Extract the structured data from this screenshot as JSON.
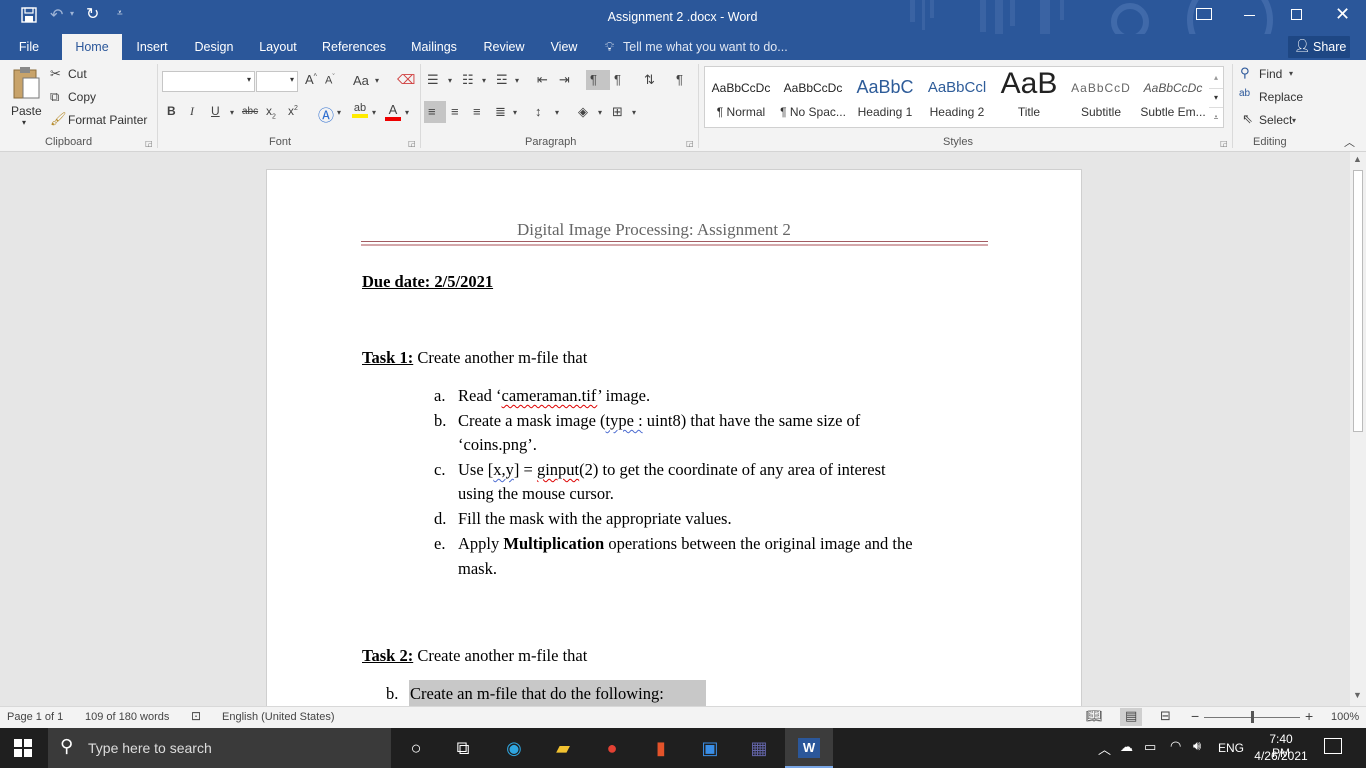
{
  "window": {
    "title": "Assignment 2 .docx - Word",
    "quick_access": {
      "save_icon": "save-icon",
      "undo_icon": "undo-icon",
      "redo_icon": "redo-icon",
      "customize_icon": "customize-icon"
    },
    "controls": {
      "ribbon_display": "ribbon-display-icon",
      "minimize": "minimize-icon",
      "restore": "restore-icon",
      "close": "close-icon"
    }
  },
  "tabs": {
    "items": [
      "File",
      "Home",
      "Insert",
      "Design",
      "Layout",
      "References",
      "Mailings",
      "Review",
      "View"
    ],
    "active": "Home",
    "tell_me": "Tell me what you want to do...",
    "share": "Share"
  },
  "ribbon": {
    "clipboard": {
      "paste": "Paste",
      "cut": "Cut",
      "copy": "Copy",
      "format_painter": "Format Painter",
      "label": "Clipboard"
    },
    "font": {
      "font_name": "",
      "font_size": "",
      "label": "Font",
      "change_case": "Aa"
    },
    "paragraph": {
      "label": "Paragraph"
    },
    "styles": {
      "label": "Styles",
      "items": [
        {
          "preview": "AaBbCcDc",
          "name": "¶ Normal"
        },
        {
          "preview": "AaBbCcDc",
          "name": "¶ No Spac..."
        },
        {
          "preview": "AaBbC",
          "name": "Heading 1"
        },
        {
          "preview": "AaBbCcl",
          "name": "Heading 2"
        },
        {
          "preview": "AaB",
          "name": "Title"
        },
        {
          "preview": "AaBbCcD",
          "name": "Subtitle"
        },
        {
          "preview": "AaBbCcDc",
          "name": "Subtle Em..."
        }
      ]
    },
    "editing": {
      "find": "Find",
      "replace": "Replace",
      "select": "Select",
      "label": "Editing"
    }
  },
  "document": {
    "header": "Digital Image Processing: Assignment 2",
    "due_date": "Due date: 2/5/2021",
    "task1": {
      "label": "Task 1:",
      "text": " Create another m-file that",
      "items": [
        {
          "marker": "a.",
          "line1_a": "Read ‘",
          "line1_sq": "cameraman.tif",
          "line1_b": "’ image."
        },
        {
          "marker": "b.",
          "line1_a": "Create a mask image (",
          "line1_sq": "type :",
          "line1_b": " uint8) that have the same size of",
          "line2": "‘coins.png’."
        },
        {
          "marker": "c.",
          "line1_a": "Use [",
          "line1_sq": "x,y",
          "line1_b": "] = ",
          "line1_sq2": "ginput",
          "line1_c": "(2) to get the coordinate of any area of interest",
          "line2": "using the mouse cursor."
        },
        {
          "marker": "d.",
          "line1": "Fill the mask with the appropriate values."
        },
        {
          "marker": "e.",
          "line1_a": "Apply ",
          "line1_bold": "Multiplication",
          "line1_b": " operations between the original image and the",
          "line2": "mask."
        }
      ]
    },
    "task2": {
      "label": "Task 2:",
      "text": " Create another m-file that",
      "item_marker": "b.",
      "item_text": "Create an m-file that do the following:"
    }
  },
  "status": {
    "page": "Page 1 of 1",
    "words": "109 of 180 words",
    "language": "English (United States)",
    "zoom": "100%",
    "zoom_level": 1.0
  },
  "taskbar": {
    "search_placeholder": "Type here to search",
    "lang": "ENG",
    "time": "7:40 PM",
    "date": "4/26/2021"
  }
}
